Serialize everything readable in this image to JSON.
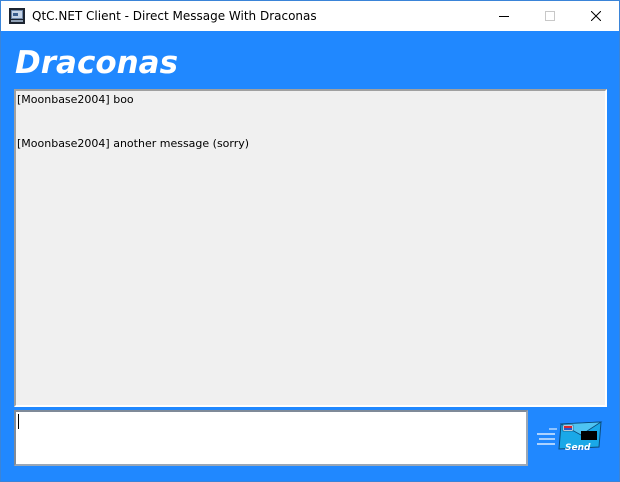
{
  "window": {
    "title": "QtC.NET Client - Direct Message With Draconas"
  },
  "header": {
    "contact_name": "Draconas"
  },
  "history": {
    "messages": [
      {
        "text": "[Moonbase2004] boo"
      },
      {
        "text": "[Moonbase2004] another message (sorry)"
      }
    ]
  },
  "compose": {
    "value": ""
  },
  "send_button": {
    "label": "Send",
    "icon": "send-envelope-icon"
  },
  "colors": {
    "background": "#2088ff",
    "history_bg": "#f0f0f0",
    "titlebar_bg": "#ffffff"
  }
}
